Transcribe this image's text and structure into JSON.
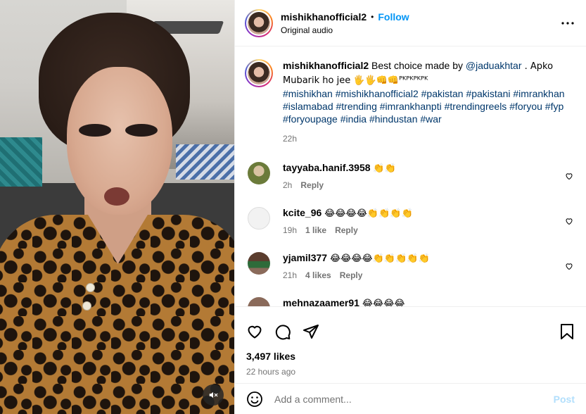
{
  "post": {
    "author": "mishikhanofficial2",
    "separator": "•",
    "follow_label": "Follow",
    "audio": "Original audio",
    "more_icon": "more-horizontal-icon"
  },
  "caption": {
    "username": "mishikhanofficial2",
    "text_before_mention": " Best choice made by ",
    "mention": "@jaduakhtar",
    "text_after_mention": " . Apko Mubarik ho jee 🖐🖐👊👊ᴾᴷᴾᴷᴾᴷᴾᴷ",
    "hashtags": "#mishikhan #mishikhanofficial2 #pakistan #pakistani #imrankhan #islamabad #trending #imrankhanpti #trendingreels #foryou #fyp #foryoupage #india #hindustan #war",
    "time": "22h"
  },
  "comments": [
    {
      "username": "tayyaba.hanif.3958",
      "text": "👏👏",
      "time": "2h",
      "likes": "",
      "reply": "Reply",
      "avatar_color": "#6b7b3a"
    },
    {
      "username": "kcite_96",
      "text": "😂😂😂😂👏👏👏👏",
      "time": "19h",
      "likes": "1 like",
      "reply": "Reply",
      "avatar_color": "#e9e9e9"
    },
    {
      "username": "yjamil377",
      "text": "😂😂😂😂👏👏👏👏👏",
      "time": "21h",
      "likes": "4 likes",
      "reply": "Reply",
      "avatar_color": "#6b4e3a"
    },
    {
      "username": "mehnazaamer91",
      "text": "😂😂😂😂",
      "time": "",
      "likes": "",
      "reply": "",
      "avatar_color": "#8a6a5a"
    }
  ],
  "actions": {
    "like_icon": "heart-icon",
    "comment_icon": "comment-icon",
    "share_icon": "share-icon",
    "save_icon": "bookmark-icon"
  },
  "stats": {
    "likes": "3,497 likes",
    "posted": "22 hours ago"
  },
  "add_comment": {
    "placeholder": "Add a comment...",
    "post_label": "Post",
    "emoji_icon": "smiley-icon"
  },
  "media": {
    "mute_icon": "muted-speaker-icon"
  },
  "colors": {
    "accent": "#0095f6",
    "link": "#00376b",
    "muted": "#737373",
    "post_disabled": "#b2dffc"
  }
}
